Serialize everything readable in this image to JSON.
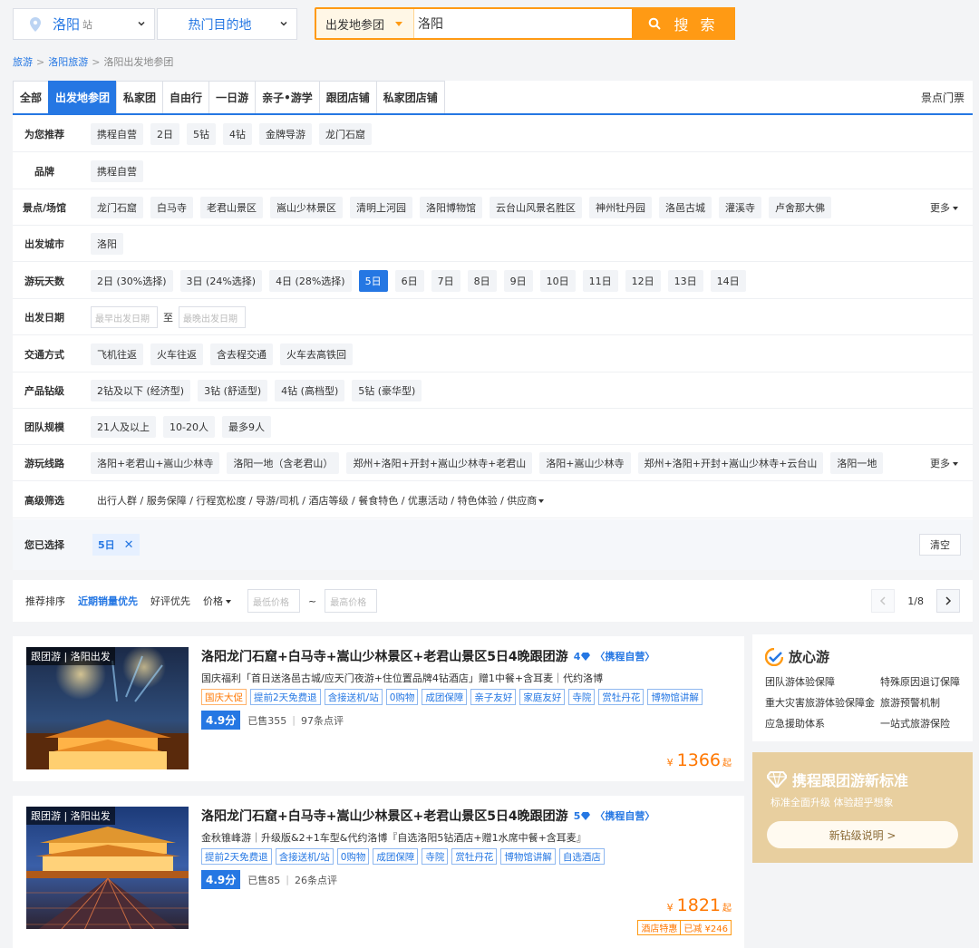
{
  "header": {
    "city": "洛阳",
    "city_suffix": "站",
    "destination": "热门目的地",
    "search_type": "出发地参团",
    "search_value": "洛阳",
    "search_button": "搜 索"
  },
  "breadcrumb": {
    "items": [
      "旅游",
      "洛阳旅游",
      "洛阳出发地参团"
    ],
    "separator": ">"
  },
  "tabs": {
    "items": [
      "全部",
      "出发地参团",
      "私家团",
      "自由行",
      "一日游",
      "亲子•游学",
      "跟团店铺",
      "私家团店铺"
    ],
    "active_index": 1,
    "right_label": "景点门票"
  },
  "filters": {
    "recommend": {
      "label": "为您推荐",
      "options": [
        "携程自营",
        "2日",
        "5钻",
        "4钻",
        "金牌导游",
        "龙门石窟"
      ]
    },
    "brand": {
      "label": "品牌",
      "options": [
        "携程自营"
      ]
    },
    "attractions": {
      "label": "景点/场馆",
      "options": [
        "龙门石窟",
        "白马寺",
        "老君山景区",
        "嵩山少林景区",
        "清明上河园",
        "洛阳博物馆",
        "云台山风景名胜区",
        "神州牡丹园",
        "洛邑古城",
        "灌溪寺",
        "卢舍那大佛"
      ],
      "more": "更多"
    },
    "departure": {
      "label": "出发城市",
      "options": [
        "洛阳"
      ]
    },
    "days": {
      "label": "游玩天数",
      "options": [
        "2日 (30%选择)",
        "3日 (24%选择)",
        "4日 (28%选择)",
        "5日",
        "6日",
        "7日",
        "8日",
        "9日",
        "10日",
        "11日",
        "12日",
        "13日",
        "14日"
      ],
      "selected_index": 3
    },
    "date": {
      "label": "出发日期",
      "start_placeholder": "最早出发日期",
      "to": "至",
      "end_placeholder": "最晚出发日期"
    },
    "transport": {
      "label": "交通方式",
      "options": [
        "飞机往返",
        "火车往返",
        "含去程交通",
        "火车去高铁回"
      ]
    },
    "rating": {
      "label": "产品钻级",
      "options": [
        "2钻及以下 (经济型)",
        "3钻 (舒适型)",
        "4钻 (高档型)",
        "5钻 (豪华型)"
      ]
    },
    "group": {
      "label": "团队规模",
      "options": [
        "21人及以上",
        "10-20人",
        "最多9人"
      ]
    },
    "routes": {
      "label": "游玩线路",
      "options": [
        "洛阳+老君山+嵩山少林寺",
        "洛阳一地（含老君山）",
        "郑州+洛阳+开封+嵩山少林寺+老君山",
        "洛阳+嵩山少林寺",
        "郑州+洛阳+开封+嵩山少林寺+云台山",
        "洛阳一地"
      ],
      "more": "更多"
    },
    "advanced": {
      "label": "高级筛选",
      "text": "出行人群 / 服务保障 / 行程宽松度 / 导游/司机 / 酒店等级 / 餐食特色 / 优惠活动 / 特色体验 / 供应商"
    },
    "selected": {
      "label": "您已选择",
      "chip": "5日",
      "clear": "清空"
    }
  },
  "sort": {
    "items": [
      "推荐排序",
      "近期销量优先",
      "好评优先"
    ],
    "active_index": 1,
    "price_label": "价格",
    "min_placeholder": "最低价格",
    "tilde": "~",
    "max_placeholder": "最高价格",
    "page": "1/8"
  },
  "products": [
    {
      "badge": "跟团游 | 洛阳出发",
      "title": "洛阳龙门石窟+白马寺+嵩山少林景区+老君山景区5日4晚跟团游",
      "diamonds": "4",
      "self_run": "〈携程自营〉",
      "desc": "国庆福利「首日送洛邑古城/应天门夜游+住位置品牌4钻酒店」赠1中餐+含耳麦｜代约洛博",
      "tags": [
        "国庆大促",
        "提前2天免费退",
        "含接送机/站",
        "0购物",
        "成团保障",
        "亲子友好",
        "家庭友好",
        "寺院",
        "赏牡丹花",
        "博物馆讲解"
      ],
      "score": "4.9分",
      "sold": "已售355",
      "reviews": "97条点评",
      "currency": "¥",
      "price": "1366",
      "price_suffix": "起"
    },
    {
      "badge": "跟团游 | 洛阳出发",
      "title": "洛阳龙门石窟+白马寺+嵩山少林景区+老君山景区5日4晚跟团游",
      "diamonds": "5",
      "self_run": "〈携程自营〉",
      "desc": "金秋锥峰游｜升级版&2+1车型&代约洛博『自选洛阳5钻酒店+赠1水席中餐+含耳麦』",
      "tags": [
        "提前2天免费退",
        "含接送机/站",
        "0购物",
        "成团保障",
        "寺院",
        "赏牡丹花",
        "博物馆讲解",
        "自选酒店"
      ],
      "score": "4.9分",
      "sold": "已售85",
      "reviews": "26条点评",
      "currency": "¥",
      "price": "1821",
      "price_suffix": "起",
      "extra_label": "酒店特惠",
      "extra_value": "已减 ¥246"
    }
  ],
  "side_guarantee": {
    "title": "放心游",
    "items": [
      "团队游体验保障",
      "特殊原因退订保障",
      "重大灾害旅游体验保障金",
      "旅游预警机制",
      "应急援助体系",
      "一站式旅游保险"
    ]
  },
  "side_promo": {
    "title": "携程跟团游新标准",
    "subtitle": "标准全面升级 体验超乎想象",
    "button": "新钻级说明 >"
  },
  "colors": {
    "primary": "#2577e3",
    "accent": "#ff9a14",
    "price": "#ff7700",
    "gold": "#e8cf9f"
  }
}
